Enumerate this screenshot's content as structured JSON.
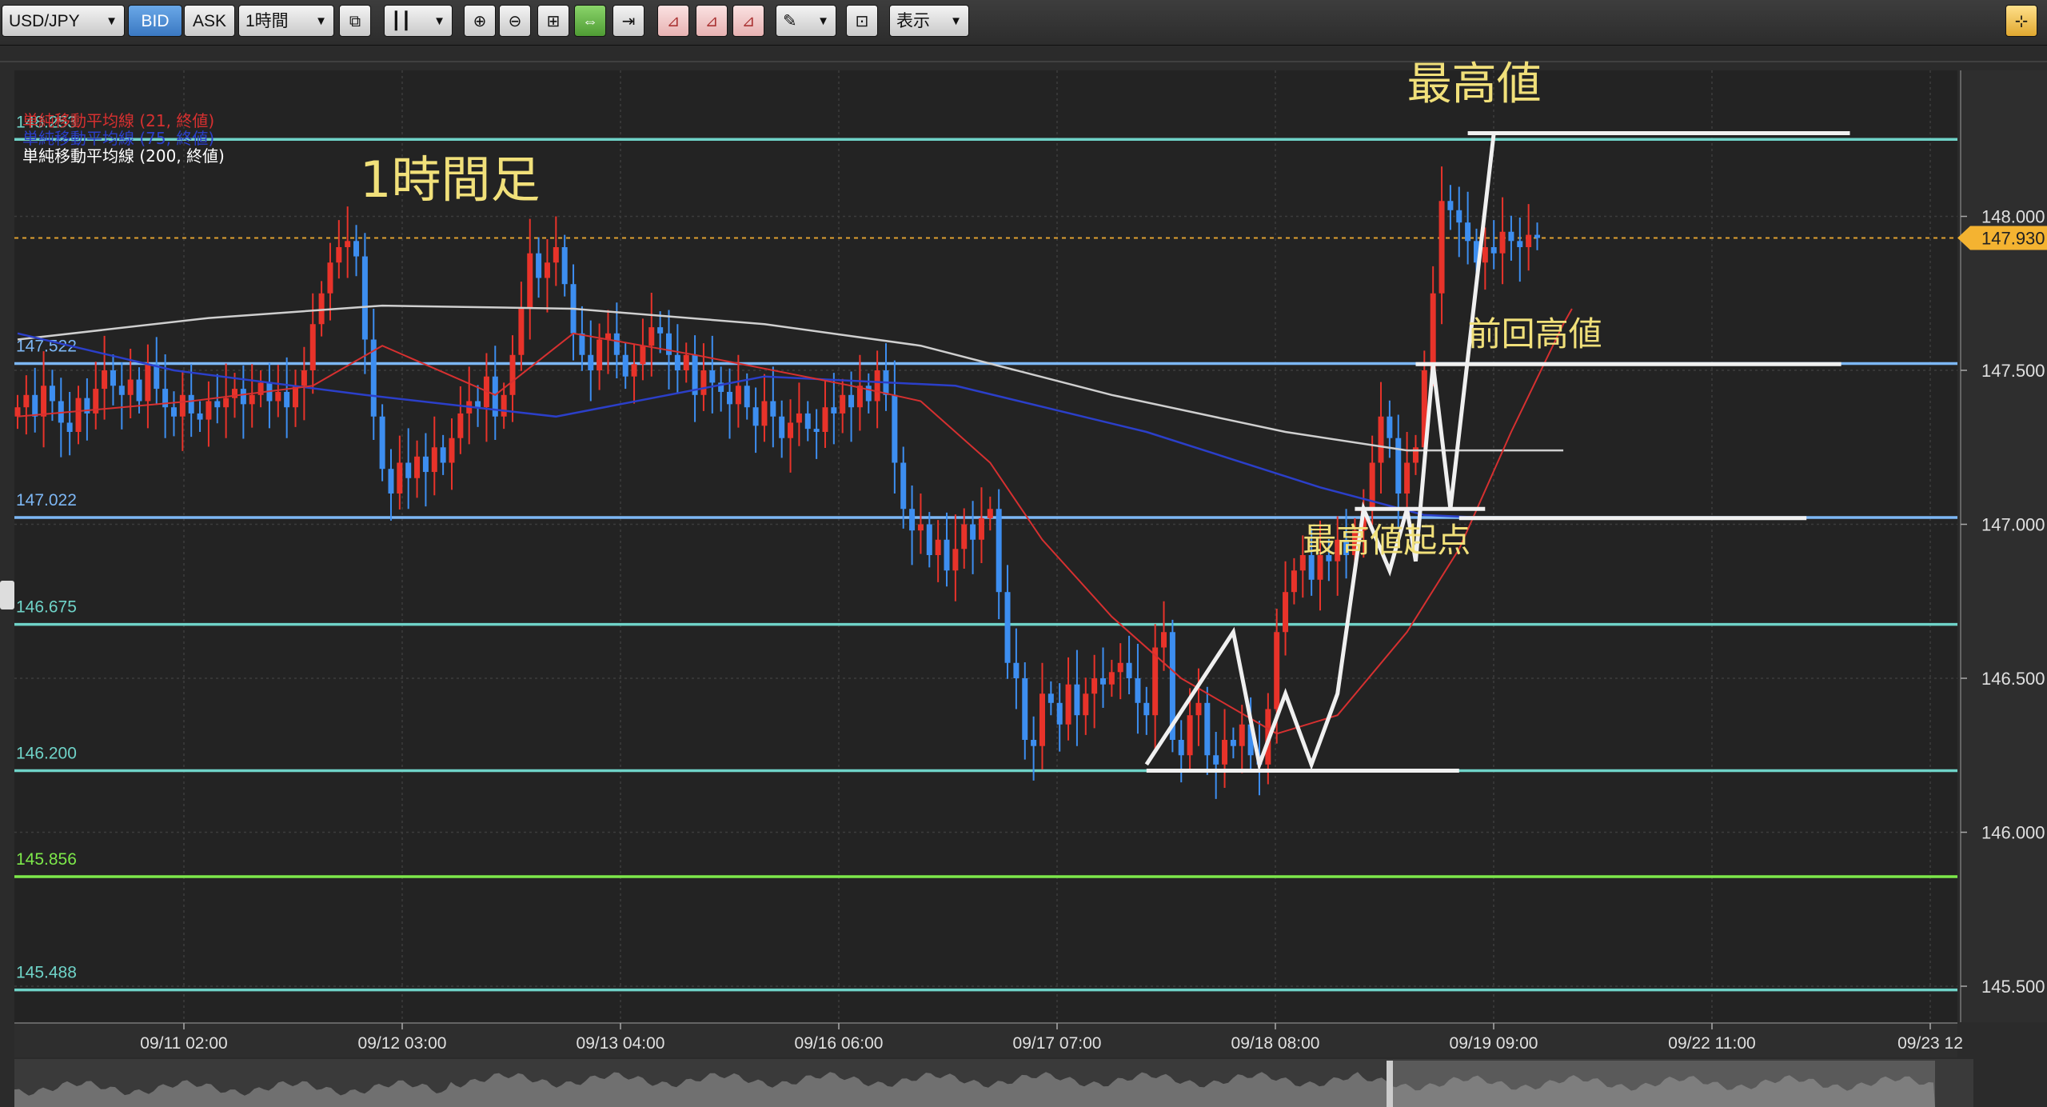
{
  "toolbar": {
    "symbol": "USD/JPY",
    "bid_label": "BID",
    "ask_label": "ASK",
    "timeframe": "1時間",
    "display_label": "表示",
    "buttons": [
      {
        "name": "compare-icon",
        "glyph": "⧉"
      },
      {
        "name": "candlestick-type-icon",
        "glyph": "┃┃"
      },
      {
        "name": "zoom-in-icon",
        "glyph": "⊕"
      },
      {
        "name": "zoom-out-icon",
        "glyph": "⊖"
      },
      {
        "name": "fit-icon",
        "glyph": "⊞"
      },
      {
        "name": "auto-scroll-icon",
        "glyph": "⇔"
      },
      {
        "name": "scroll-end-icon",
        "glyph": "⇥"
      },
      {
        "name": "indicator-add-icon",
        "glyph": "⊿"
      },
      {
        "name": "indicator-edit-icon",
        "glyph": "⊿"
      },
      {
        "name": "indicator-remove-icon",
        "glyph": "⊿"
      },
      {
        "name": "draw-tool-icon",
        "glyph": "✎"
      },
      {
        "name": "chart-settings-icon",
        "glyph": "⊡"
      },
      {
        "name": "fullscreen-icon",
        "glyph": "⊹"
      }
    ]
  },
  "indicators": [
    {
      "label": "単純移動平均線 (21, 終値)",
      "color": "#d63030"
    },
    {
      "label": "単純移動平均線 (75, 終値)",
      "color": "#2b3fc9"
    },
    {
      "label": "単純移動平均線 (200, 終値)",
      "color": "#ffffff"
    }
  ],
  "chart_data": {
    "type": "candlestick",
    "title": "1時間足",
    "ylim": [
      145.3,
      148.5
    ],
    "y_ticks": [
      "148.000",
      "147.500",
      "147.000",
      "146.500",
      "146.000",
      "145.500"
    ],
    "current_price": "147.930",
    "x_ticks": [
      "09/11 02:00",
      "09/12 03:00",
      "09/13 04:00",
      "09/16 06:00",
      "09/17 07:00",
      "09/18 08:00",
      "09/19 09:00",
      "09/22 11:00",
      "09/23 12"
    ],
    "horizontal_levels": [
      {
        "label": "148.253",
        "value": 148.25,
        "color": "#6fd3c8"
      },
      {
        "label": "147.522",
        "value": 147.522,
        "color": "#7db7f5"
      },
      {
        "label": "147.022",
        "value": 147.022,
        "color": "#7db7f5"
      },
      {
        "label": "146.675",
        "value": 146.675,
        "color": "#6fd3c8"
      },
      {
        "label": "146.200",
        "value": 146.2,
        "color": "#6fd3c8"
      },
      {
        "label": "145.856",
        "value": 145.856,
        "color": "#7de84a"
      },
      {
        "label": "145.488",
        "value": 145.488,
        "color": "#6fd3c8"
      }
    ],
    "annotations": [
      {
        "text": "最高値",
        "x_index": 160,
        "y": 148.38,
        "size": 56
      },
      {
        "text": "前回高値",
        "x_index": 167,
        "y": 147.58,
        "size": 42
      },
      {
        "text": "最高値起点",
        "x_index": 148,
        "y": 146.91,
        "size": 42
      }
    ],
    "closes": [
      147.38,
      147.42,
      147.35,
      147.45,
      147.4,
      147.33,
      147.3,
      147.41,
      147.36,
      147.44,
      147.5,
      147.45,
      147.42,
      147.47,
      147.4,
      147.52,
      147.44,
      147.38,
      147.35,
      147.42,
      147.36,
      147.34,
      147.4,
      147.38,
      147.41,
      147.44,
      147.39,
      147.42,
      147.46,
      147.4,
      147.43,
      147.38,
      147.45,
      147.5,
      147.65,
      147.75,
      147.85,
      147.9,
      147.92,
      147.87,
      147.6,
      147.35,
      147.18,
      147.1,
      147.2,
      147.15,
      147.22,
      147.17,
      147.25,
      147.2,
      147.28,
      147.36,
      147.4,
      147.38,
      147.48,
      147.35,
      147.42,
      147.55,
      147.7,
      147.88,
      147.8,
      147.85,
      147.9,
      147.78,
      147.62,
      147.55,
      147.5,
      147.6,
      147.62,
      147.55,
      147.48,
      147.52,
      147.58,
      147.64,
      147.62,
      147.55,
      147.5,
      147.55,
      147.42,
      147.5,
      147.46,
      147.43,
      147.39,
      147.45,
      147.38,
      147.32,
      147.4,
      147.35,
      147.28,
      147.33,
      147.36,
      147.31,
      147.3,
      147.38,
      147.36,
      147.42,
      147.38,
      147.45,
      147.4,
      147.5,
      147.42,
      147.2,
      147.05,
      146.98,
      147.0,
      146.9,
      146.95,
      146.85,
      146.92,
      147.0,
      146.95,
      147.02,
      147.05,
      146.78,
      146.55,
      146.5,
      146.3,
      146.28,
      146.45,
      146.42,
      146.35,
      146.48,
      146.38,
      146.45,
      146.5,
      146.48,
      146.52,
      146.55,
      146.5,
      146.42,
      146.38,
      146.6,
      146.65,
      146.3,
      146.25,
      146.38,
      146.42,
      146.25,
      146.22,
      146.3,
      146.28,
      146.35,
      146.25,
      146.22,
      146.4,
      146.65,
      146.78,
      146.85,
      146.9,
      146.82,
      146.9,
      146.88,
      146.95,
      146.9,
      146.98,
      147.05,
      147.2,
      147.35,
      147.28,
      147.1,
      147.2,
      147.25,
      147.5,
      147.75,
      148.05,
      148.02,
      147.98,
      147.92,
      147.85,
      147.9,
      147.88,
      147.95,
      147.92,
      147.9,
      147.94,
      147.93
    ],
    "sma21": [
      [
        0,
        147.35
      ],
      [
        20,
        147.4
      ],
      [
        34,
        147.45
      ],
      [
        42,
        147.58
      ],
      [
        55,
        147.42
      ],
      [
        64,
        147.62
      ],
      [
        78,
        147.55
      ],
      [
        96,
        147.45
      ],
      [
        104,
        147.4
      ],
      [
        112,
        147.2
      ],
      [
        118,
        146.95
      ],
      [
        126,
        146.7
      ],
      [
        134,
        146.5
      ],
      [
        145,
        146.32
      ],
      [
        152,
        146.38
      ],
      [
        160,
        146.65
      ],
      [
        166,
        146.92
      ],
      [
        172,
        147.3
      ],
      [
        178,
        147.65
      ],
      [
        179,
        147.7
      ]
    ],
    "sma75": [
      [
        0,
        147.62
      ],
      [
        18,
        147.5
      ],
      [
        40,
        147.42
      ],
      [
        62,
        147.35
      ],
      [
        86,
        147.48
      ],
      [
        108,
        147.45
      ],
      [
        130,
        147.3
      ],
      [
        150,
        147.12
      ],
      [
        162,
        147.03
      ],
      [
        170,
        147.02
      ]
    ],
    "sma200": [
      [
        0,
        147.6
      ],
      [
        22,
        147.67
      ],
      [
        42,
        147.71
      ],
      [
        64,
        147.7
      ],
      [
        86,
        147.65
      ],
      [
        104,
        147.58
      ],
      [
        126,
        147.42
      ],
      [
        146,
        147.3
      ],
      [
        160,
        147.24
      ],
      [
        178,
        147.24
      ]
    ],
    "drawn_lines": [
      [
        [
          130,
          146.22
        ],
        [
          140,
          146.65
        ],
        [
          143,
          146.22
        ],
        [
          146,
          146.45
        ],
        [
          149,
          146.22
        ],
        [
          152,
          146.45
        ],
        [
          155,
          147.05
        ],
        [
          158,
          146.85
        ],
        [
          160,
          147.05
        ],
        [
          161,
          146.88
        ],
        [
          163,
          147.52
        ],
        [
          165,
          147.05
        ],
        [
          170,
          148.27
        ]
      ],
      [
        [
          130,
          146.2
        ],
        [
          166,
          146.2
        ]
      ],
      [
        [
          154,
          147.05
        ],
        [
          169,
          147.05
        ]
      ],
      [
        [
          161,
          147.52
        ],
        [
          210,
          147.52
        ]
      ],
      [
        [
          166,
          147.02
        ],
        [
          206,
          147.02
        ]
      ],
      [
        [
          167,
          148.27
        ],
        [
          211,
          148.27
        ]
      ]
    ]
  }
}
